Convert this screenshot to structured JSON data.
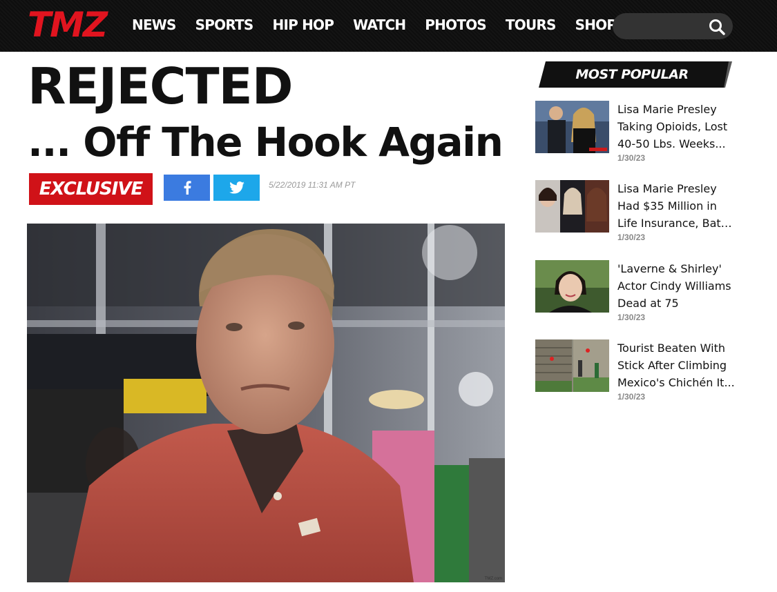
{
  "header": {
    "logo": "TMZ",
    "nav": [
      "NEWS",
      "SPORTS",
      "HIP HOP",
      "WATCH",
      "PHOTOS",
      "TOURS",
      "SHOP"
    ],
    "search_placeholder": ""
  },
  "article": {
    "headline_line1": "REJECTED",
    "headline_line2": "... Off The Hook Again",
    "badge": "EXCLUSIVE",
    "timestamp": "5/22/2019 11:31 AM PT",
    "photo_credit": "TMZ.com"
  },
  "sidebar": {
    "title": "MOST POPULAR",
    "items": [
      {
        "title_lines": [
          "Lisa Marie Presley",
          "Taking Opioids, Lost",
          "40-50 Lbs. Weeks..."
        ],
        "date": "1/30/23"
      },
      {
        "title_lines": [
          "Lisa Marie Presley",
          "Had $35 Million in",
          "Life Insurance, Batt..."
        ],
        "date": "1/30/23"
      },
      {
        "title_lines": [
          "'Laverne & Shirley'",
          "Actor Cindy Williams",
          "Dead at 75"
        ],
        "date": "1/30/23"
      },
      {
        "title_lines": [
          "Tourist Beaten With",
          "Stick After Climbing",
          "Mexico's Chichén It..."
        ],
        "date": "1/30/23"
      }
    ]
  },
  "colors": {
    "brand_red": "#e1141f",
    "badge_red": "#d01218",
    "facebook": "#3b7be0",
    "twitter": "#1da7ea",
    "header_bg": "#111111"
  },
  "icons": [
    "search-icon",
    "facebook-icon",
    "twitter-icon"
  ]
}
